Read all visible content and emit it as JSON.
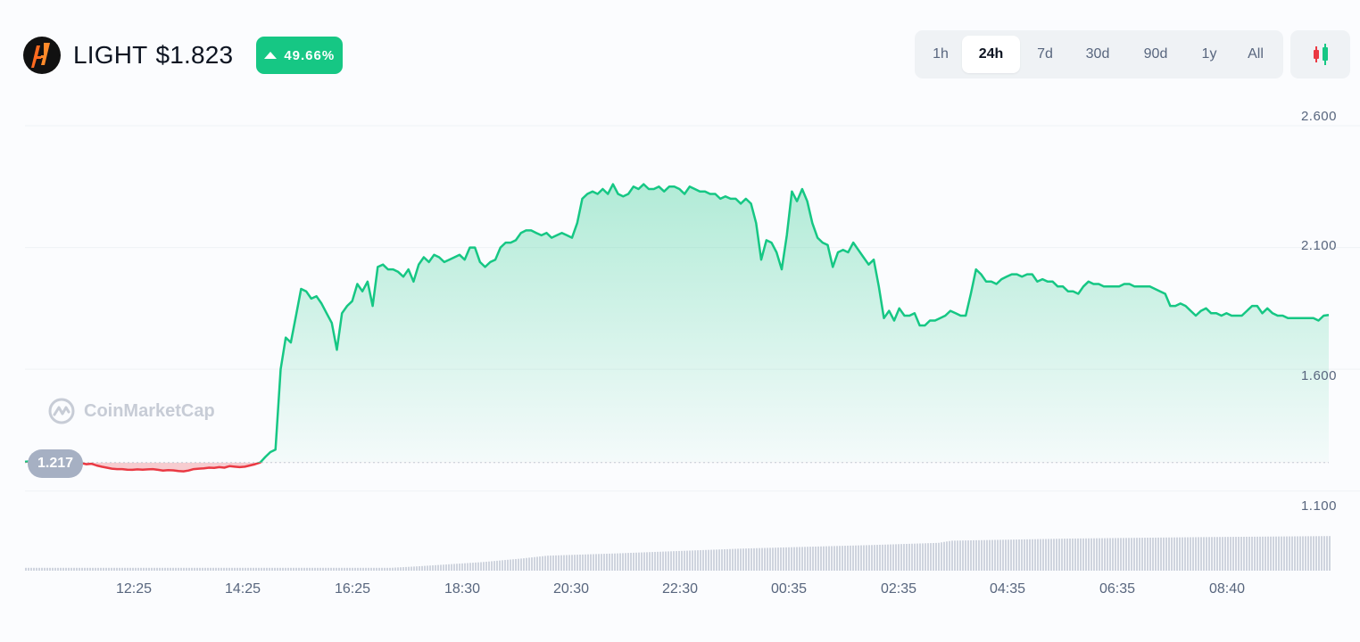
{
  "coin": {
    "symbol": "LIGHT",
    "price": "$1.823",
    "change": "49.66%"
  },
  "ranges": [
    "1h",
    "24h",
    "7d",
    "30d",
    "90d",
    "1y",
    "All"
  ],
  "active_range": "24h",
  "open_price_label": "1.217",
  "watermark": "CoinMarketCap",
  "colors": {
    "up": "#16c784",
    "down": "#ea3943",
    "volume": "#cfd4de",
    "grid": "#eff2f5"
  },
  "chart_data": {
    "type": "area",
    "reference_price": 1.217,
    "ylim": [
      1.0,
      2.6
    ],
    "y_ticks": [
      "2.600",
      "2.100",
      "1.600",
      "1.100"
    ],
    "x_ticks": [
      "12:25",
      "14:25",
      "16:25",
      "18:30",
      "20:30",
      "22:30",
      "00:35",
      "02:35",
      "04:35",
      "06:35",
      "08:40"
    ],
    "price": [
      1.22,
      1.222,
      1.221,
      1.223,
      1.222,
      1.224,
      1.222,
      1.223,
      1.221,
      1.22,
      1.217,
      1.215,
      1.21,
      1.212,
      1.205,
      1.2,
      1.196,
      1.192,
      1.19,
      1.19,
      1.188,
      1.187,
      1.189,
      1.188,
      1.189,
      1.19,
      1.187,
      1.184,
      1.186,
      1.185,
      1.182,
      1.181,
      1.184,
      1.19,
      1.192,
      1.193,
      1.196,
      1.195,
      1.198,
      1.196,
      1.202,
      1.2,
      1.198,
      1.2,
      1.205,
      1.21,
      1.217,
      1.24,
      1.26,
      1.27,
      1.6,
      1.73,
      1.71,
      1.82,
      1.93,
      1.92,
      1.89,
      1.9,
      1.87,
      1.83,
      1.79,
      1.68,
      1.83,
      1.86,
      1.88,
      1.95,
      1.92,
      1.96,
      1.86,
      2.02,
      2.03,
      2.01,
      2.01,
      2.0,
      1.98,
      2.01,
      1.96,
      2.03,
      2.06,
      2.04,
      2.07,
      2.06,
      2.04,
      2.05,
      2.06,
      2.07,
      2.05,
      2.1,
      2.1,
      2.04,
      2.02,
      2.04,
      2.05,
      2.1,
      2.12,
      2.12,
      2.13,
      2.16,
      2.17,
      2.17,
      2.16,
      2.15,
      2.16,
      2.14,
      2.15,
      2.16,
      2.15,
      2.14,
      2.2,
      2.3,
      2.32,
      2.33,
      2.32,
      2.34,
      2.32,
      2.36,
      2.32,
      2.31,
      2.32,
      2.35,
      2.34,
      2.36,
      2.34,
      2.34,
      2.35,
      2.33,
      2.35,
      2.35,
      2.34,
      2.32,
      2.35,
      2.34,
      2.33,
      2.33,
      2.32,
      2.32,
      2.3,
      2.31,
      2.3,
      2.3,
      2.28,
      2.3,
      2.28,
      2.2,
      2.05,
      2.13,
      2.12,
      2.08,
      2.01,
      2.15,
      2.33,
      2.29,
      2.34,
      2.29,
      2.2,
      2.14,
      2.12,
      2.11,
      2.02,
      2.08,
      2.09,
      2.08,
      2.12,
      2.09,
      2.06,
      2.03,
      2.05,
      1.94,
      1.81,
      1.84,
      1.8,
      1.85,
      1.82,
      1.82,
      1.83,
      1.78,
      1.78,
      1.8,
      1.8,
      1.81,
      1.82,
      1.84,
      1.83,
      1.82,
      1.82,
      1.91,
      2.01,
      1.99,
      1.96,
      1.96,
      1.95,
      1.97,
      1.98,
      1.99,
      1.99,
      1.98,
      1.99,
      1.99,
      1.96,
      1.97,
      1.96,
      1.96,
      1.94,
      1.94,
      1.92,
      1.92,
      1.91,
      1.94,
      1.96,
      1.95,
      1.95,
      1.94,
      1.94,
      1.94,
      1.94,
      1.95,
      1.95,
      1.94,
      1.94,
      1.94,
      1.94,
      1.93,
      1.92,
      1.91,
      1.86,
      1.86,
      1.87,
      1.86,
      1.84,
      1.82,
      1.84,
      1.85,
      1.83,
      1.83,
      1.82,
      1.83,
      1.82,
      1.82,
      1.82,
      1.84,
      1.86,
      1.86,
      1.83,
      1.85,
      1.83,
      1.82,
      1.82,
      1.81,
      1.81,
      1.81,
      1.81,
      1.81,
      1.81,
      1.8,
      1.82,
      1.823
    ],
    "volume_profile": [
      [
        0,
        0.08
      ],
      [
        0.28,
        0.08
      ],
      [
        0.3,
        0.12
      ],
      [
        0.35,
        0.24
      ],
      [
        0.38,
        0.34
      ],
      [
        0.4,
        0.42
      ],
      [
        0.45,
        0.48
      ],
      [
        0.5,
        0.55
      ],
      [
        0.55,
        0.62
      ],
      [
        0.6,
        0.67
      ],
      [
        0.65,
        0.72
      ],
      [
        0.7,
        0.78
      ],
      [
        0.71,
        0.84
      ],
      [
        0.8,
        0.9
      ],
      [
        0.9,
        0.94
      ],
      [
        1.0,
        0.97
      ]
    ]
  }
}
